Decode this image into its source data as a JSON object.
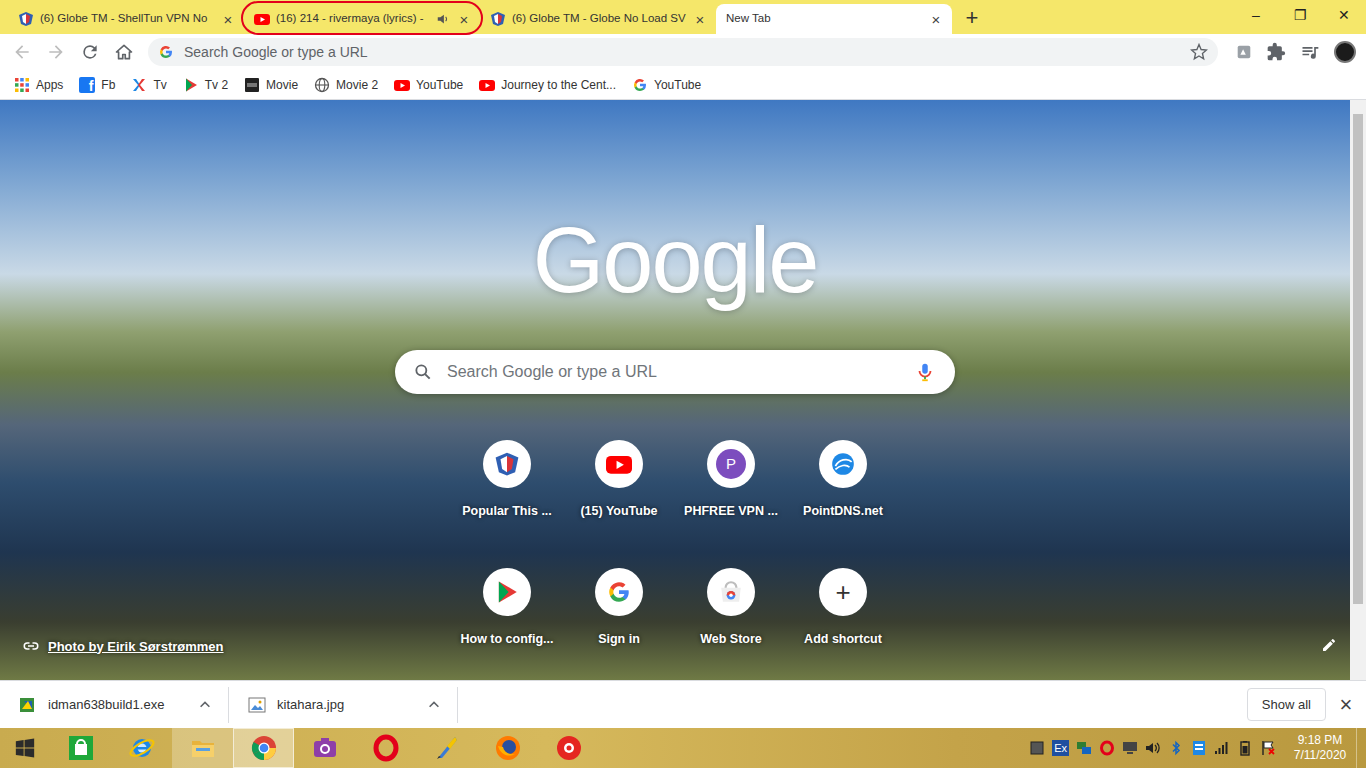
{
  "window": {
    "controls": [
      "–",
      "❐",
      "✕"
    ]
  },
  "tabs": {
    "close_glyph": "×",
    "new_tab": "+",
    "items": [
      {
        "label": "(6) Globe TM - ShellTun VPN No",
        "kind": "globe",
        "selected": false,
        "audible": false,
        "circled": false
      },
      {
        "label": "(16) 214 - rivermaya (lyrics) -",
        "kind": "youtube",
        "selected": false,
        "audible": true,
        "circled": true
      },
      {
        "label": "(6) Globe TM - Globe No Load SV",
        "kind": "globe",
        "selected": false,
        "audible": false,
        "circled": false
      },
      {
        "label": "New Tab",
        "kind": "none",
        "selected": true,
        "audible": false,
        "circled": false
      }
    ]
  },
  "toolbar": {
    "omnibox_placeholder": "Search Google or type a URL",
    "back_enabled": false,
    "forward_enabled": false
  },
  "bookmarks": [
    {
      "label": "Apps",
      "kind": "apps"
    },
    {
      "label": "Fb",
      "kind": "facebook",
      "icon_text": "f"
    },
    {
      "label": "Tv",
      "kind": "tv"
    },
    {
      "label": "Tv 2",
      "kind": "play"
    },
    {
      "label": "Movie",
      "kind": "movie"
    },
    {
      "label": "Movie 2",
      "kind": "globe"
    },
    {
      "label": "YouTube",
      "kind": "youtube"
    },
    {
      "label": "Journey to the Cent...",
      "kind": "youtube"
    },
    {
      "label": "YouTube",
      "kind": "google"
    }
  ],
  "ntp": {
    "logo": "Google",
    "search_placeholder": "Search Google or type a URL",
    "shortcuts": [
      {
        "label": "Popular This ...",
        "kind": "globe"
      },
      {
        "label": "(15) YouTube",
        "kind": "youtube"
      },
      {
        "label": "PHFREE VPN ...",
        "kind": "letter",
        "icon_text": "P"
      },
      {
        "label": "PointDNS.net",
        "kind": "dns"
      },
      {
        "label": "How to config...",
        "kind": "play"
      },
      {
        "label": "Sign in",
        "kind": "google"
      },
      {
        "label": "Web Store",
        "kind": "webstore"
      },
      {
        "label": "Add shortcut",
        "kind": "add",
        "icon_text": "+"
      }
    ],
    "photo_credit": "Photo by Eirik Sørstrømmen"
  },
  "downloads": {
    "items": [
      {
        "name": "idman638build1.exe",
        "kind": "exe"
      },
      {
        "name": "kitahara.jpg",
        "kind": "image"
      }
    ],
    "show_all": "Show all",
    "close": "×"
  },
  "taskbar": {
    "apps": [
      {
        "kind": "store",
        "running": false,
        "active": false
      },
      {
        "kind": "ie",
        "running": false,
        "active": false
      },
      {
        "kind": "explorer",
        "running": true,
        "active": false
      },
      {
        "kind": "chrome",
        "running": true,
        "active": true
      },
      {
        "kind": "camera",
        "running": false,
        "active": false
      },
      {
        "kind": "opera",
        "running": false,
        "active": false
      },
      {
        "kind": "quill",
        "running": false,
        "active": false
      },
      {
        "kind": "firefox",
        "running": false,
        "active": false
      },
      {
        "kind": "yandex",
        "running": false,
        "active": false
      }
    ],
    "tray": [
      {
        "kind": "box"
      },
      {
        "kind": "text",
        "text": "Ex"
      },
      {
        "kind": "network"
      },
      {
        "kind": "opera"
      },
      {
        "kind": "monitor"
      },
      {
        "kind": "volume"
      },
      {
        "kind": "bluetooth"
      },
      {
        "kind": "app"
      },
      {
        "kind": "signal"
      },
      {
        "kind": "battery"
      },
      {
        "kind": "flag"
      }
    ],
    "time": "9:18 PM",
    "date": "7/11/2020"
  }
}
